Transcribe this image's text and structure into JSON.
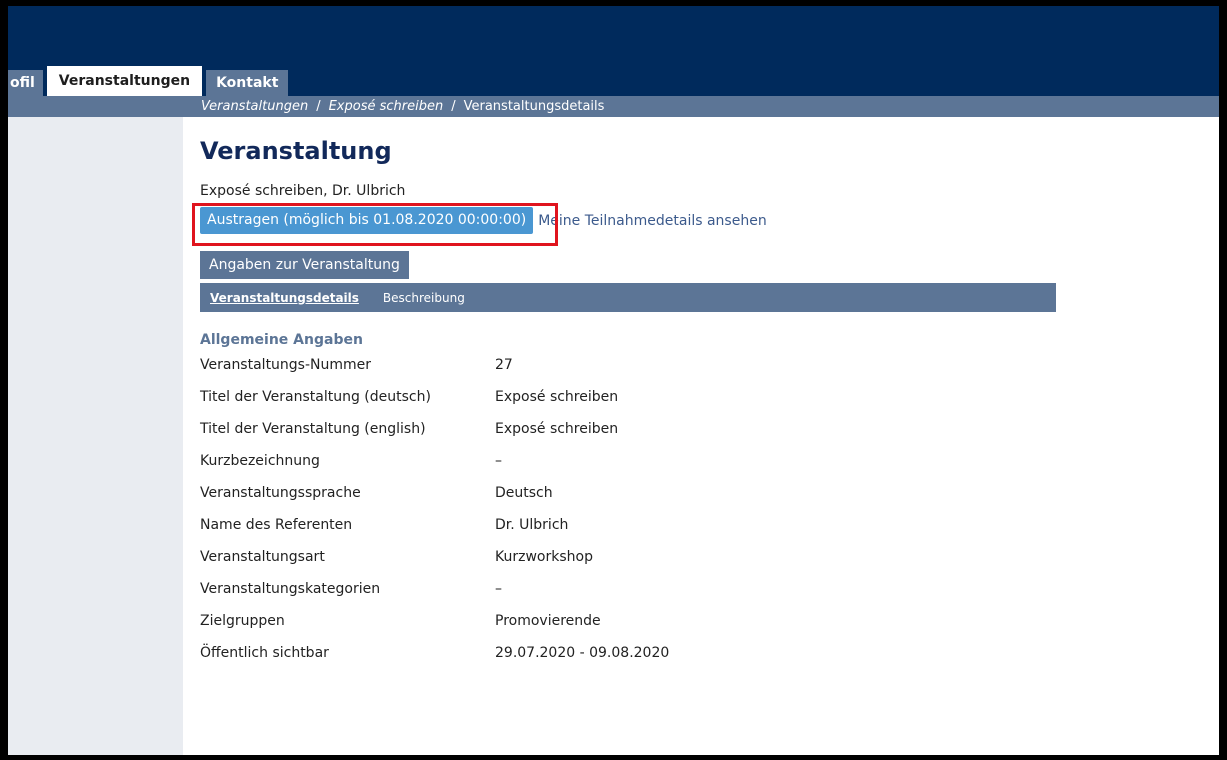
{
  "nav": {
    "tabs": [
      {
        "label": "ofil"
      },
      {
        "label": "Veranstaltungen"
      },
      {
        "label": "Kontakt"
      }
    ]
  },
  "breadcrumb": {
    "items": [
      "Veranstaltungen",
      "Exposé schreiben",
      "Veranstaltungsdetails"
    ],
    "separator": "/"
  },
  "page": {
    "title": "Veranstaltung",
    "subtitle": "Exposé schreiben, Dr. Ulbrich",
    "unregister_button": "Austragen (möglich bis 01.08.2020 00:00:00)",
    "participation_link": "Meine Teilnahmedetails ansehen",
    "section_button": "Angaben zur Veranstaltung",
    "subtabs": [
      "Veranstaltungsdetails",
      "Beschreibung"
    ],
    "section_heading": "Allgemeine Angaben",
    "details": [
      {
        "label": "Veranstaltungs-Nummer",
        "value": "27"
      },
      {
        "label": "Titel der Veranstaltung (deutsch)",
        "value": "Exposé schreiben"
      },
      {
        "label": "Titel der Veranstaltung (english)",
        "value": "Exposé schreiben"
      },
      {
        "label": "Kurzbezeichnung",
        "value": "–"
      },
      {
        "label": "Veranstaltungssprache",
        "value": "Deutsch"
      },
      {
        "label": "Name des Referenten",
        "value": "Dr. Ulbrich"
      },
      {
        "label": "Veranstaltungsart",
        "value": "Kurzworkshop"
      },
      {
        "label": "Veranstaltungskategorien",
        "value": "–"
      },
      {
        "label": "Zielgruppen",
        "value": "Promovierende"
      },
      {
        "label": "Öffentlich sichtbar",
        "value": "29.07.2020 - 09.08.2020"
      }
    ]
  },
  "colors": {
    "header_bg": "#002a5c",
    "nav_bg": "#5c7596",
    "primary_button": "#4a97d2",
    "highlight_border": "#e0141e",
    "sidebar_bg": "#e9ecf1"
  }
}
